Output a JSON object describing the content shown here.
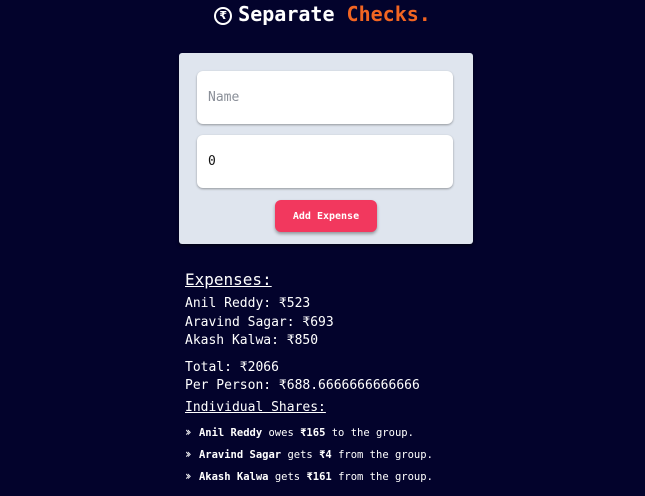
{
  "header": {
    "icon": "rupee-circle-icon",
    "title_main": "Separate",
    "title_accent": "Checks.",
    "accent_color": "#f26522"
  },
  "form": {
    "name_placeholder": "Name",
    "name_value": "",
    "amount_value": "0",
    "add_button_label": "Add Expense",
    "button_color": "#f2385e"
  },
  "expenses": {
    "heading": "Expenses:",
    "items": [
      "Anil Reddy: ₹523",
      "Aravind Sagar: ₹693",
      "Akash Kalwa: ₹850"
    ]
  },
  "summary": {
    "total": "Total: ₹2066",
    "per_person": "Per Person: ₹688.6666666666666"
  },
  "shares": {
    "heading": "Individual Shares:",
    "rows": [
      {
        "name": "Anil Reddy",
        "verb": "owes",
        "amount": "₹165",
        "tail": "to the group."
      },
      {
        "name": "Aravind Sagar",
        "verb": "gets",
        "amount": "₹4",
        "tail": "from the group."
      },
      {
        "name": "Akash Kalwa",
        "verb": "gets",
        "amount": "₹161",
        "tail": "from the group."
      }
    ]
  }
}
